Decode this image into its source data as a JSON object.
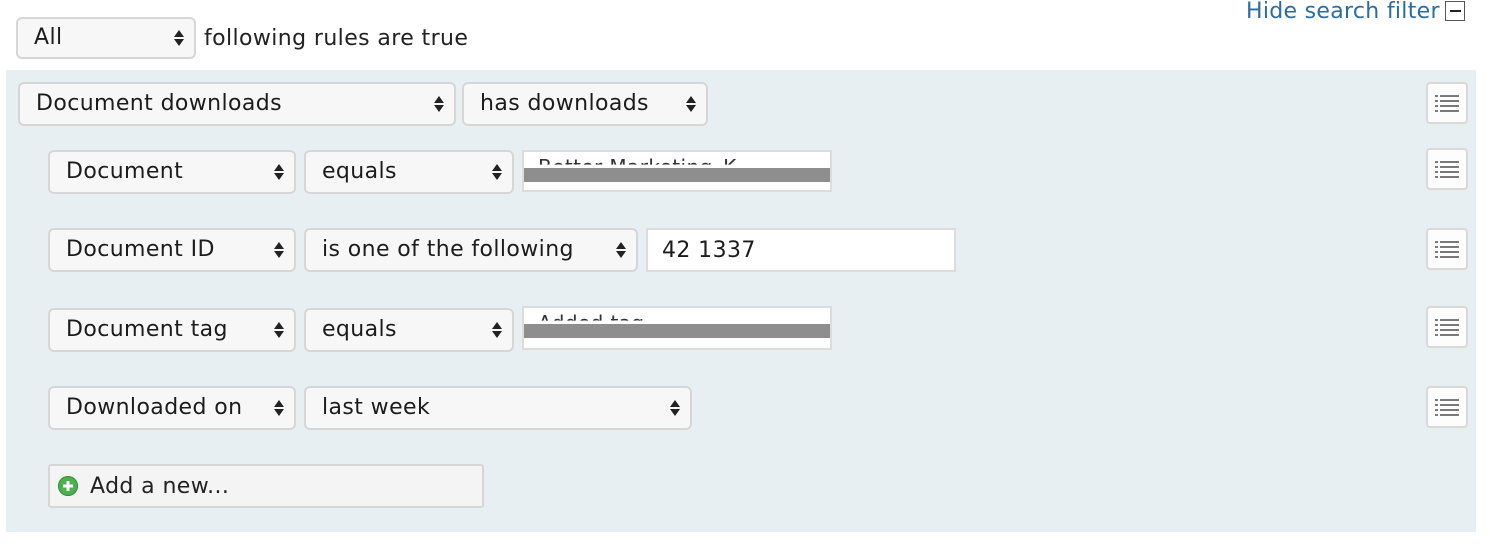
{
  "header": {
    "match_select": "All",
    "match_suffix": "following rules are true",
    "hide_filter_link": "Hide search filter",
    "collapse_icon": "minus-box-icon"
  },
  "group": {
    "field": "Document downloads",
    "operator": "has downloads",
    "menu_icon": "list-menu-icon"
  },
  "rules": [
    {
      "field": "Document",
      "operator": "equals",
      "value": "Better Marketing_K",
      "redacted": true
    },
    {
      "field": "Document ID",
      "operator": "is one of the following",
      "value": "42 1337",
      "redacted": false
    },
    {
      "field": "Document tag",
      "operator": "equals",
      "value": "Added tag",
      "redacted": true
    },
    {
      "field": "Downloaded on",
      "operator": "last week"
    }
  ],
  "add_button": {
    "label": "Add a new...",
    "icon": "plus-circle-icon"
  },
  "colors": {
    "panel_bg": "#e8eff3",
    "link": "#2a6ca3",
    "add_icon": "#4caf50",
    "redaction": "#8e8e8e"
  }
}
